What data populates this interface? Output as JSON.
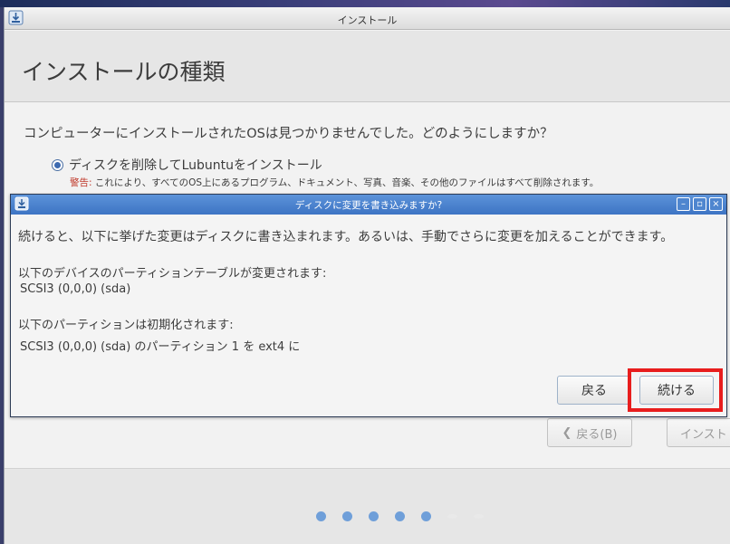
{
  "window": {
    "title": "インストール"
  },
  "page": {
    "title": "インストールの種類",
    "question": "コンピューターにインストールされたOSは見つかりませんでした。どのようにしますか？",
    "option_label": "ディスクを削除してLubuntuをインストール",
    "warning_prefix": "警告:",
    "warning_text": " これにより、すべてのOS上にあるプログラム、ドキュメント、写真、音楽、その他のファイルはすべて削除されます。"
  },
  "navigation": {
    "back_label": "戻る(B)",
    "install_label": "インスト",
    "progress": {
      "total_steps": 7,
      "completed_steps": 5
    }
  },
  "dialog": {
    "title": "ディスクに変更を書き込みますか?",
    "message": "続けると、以下に挙げた変更はディスクに書き込まれます。あるいは、手動でさらに変更を加えることができます。",
    "partition_table_heading": "以下のデバイスのパーティションテーブルが変更されます:",
    "partition_table_device": "SCSI3 (0,0,0) (sda)",
    "format_heading": "以下のパーティションは初期化されます:",
    "format_detail": "SCSI3 (0,0,0) (sda) のパーティション 1 を ext4 に",
    "back_button": "戻る",
    "continue_button": "続ける",
    "window_buttons": [
      "–",
      "▫",
      "×"
    ]
  },
  "colors": {
    "accent": "#3d6ab0",
    "dialog_titlebar": "#4a80cc",
    "highlight": "#e81d1d",
    "warning": "#c0392b"
  }
}
